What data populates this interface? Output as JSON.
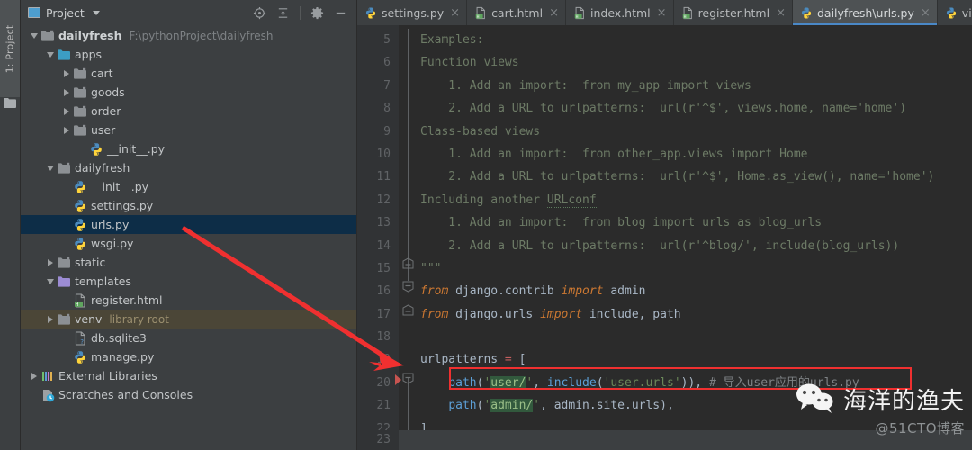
{
  "toolstrip": {
    "tab_label": "1: Project",
    "folder_icon": "folder-icon"
  },
  "project_panel": {
    "title": "Project",
    "dropdown_icon": "chevron-down-icon",
    "actions": [
      {
        "name": "locate-icon",
        "label": "Select Opened File"
      },
      {
        "name": "collapse-all-icon",
        "label": "Collapse All"
      },
      {
        "name": "gear-icon",
        "label": "Settings"
      },
      {
        "name": "minimize-icon",
        "label": "Hide"
      }
    ],
    "tree": [
      {
        "label": "dailyfresh",
        "sub": "F:\\pythonProject\\dailyfresh",
        "indent": 0,
        "twist": "down",
        "icon": "folder-module-icon",
        "bold": true,
        "state": "normal"
      },
      {
        "label": "apps",
        "sub": "",
        "indent": 1,
        "twist": "down",
        "icon": "folder-source-icon",
        "bold": false,
        "state": "normal"
      },
      {
        "label": "cart",
        "sub": "",
        "indent": 2,
        "twist": "right",
        "icon": "folder-icon",
        "bold": false,
        "state": "normal"
      },
      {
        "label": "goods",
        "sub": "",
        "indent": 2,
        "twist": "right",
        "icon": "folder-icon",
        "bold": false,
        "state": "normal"
      },
      {
        "label": "order",
        "sub": "",
        "indent": 2,
        "twist": "right",
        "icon": "folder-icon",
        "bold": false,
        "state": "normal"
      },
      {
        "label": "user",
        "sub": "",
        "indent": 2,
        "twist": "right",
        "icon": "folder-icon",
        "bold": false,
        "state": "normal"
      },
      {
        "label": "__init__.py",
        "sub": "",
        "indent": 3,
        "twist": "none",
        "icon": "python-file-icon",
        "bold": false,
        "state": "normal"
      },
      {
        "label": "dailyfresh",
        "sub": "",
        "indent": 1,
        "twist": "down",
        "icon": "folder-icon",
        "bold": false,
        "state": "normal"
      },
      {
        "label": "__init__.py",
        "sub": "",
        "indent": 2,
        "twist": "none",
        "icon": "python-file-icon",
        "bold": false,
        "state": "normal"
      },
      {
        "label": "settings.py",
        "sub": "",
        "indent": 2,
        "twist": "none",
        "icon": "python-file-icon",
        "bold": false,
        "state": "normal"
      },
      {
        "label": "urls.py",
        "sub": "",
        "indent": 2,
        "twist": "none",
        "icon": "python-file-icon",
        "bold": false,
        "state": "selected"
      },
      {
        "label": "wsgi.py",
        "sub": "",
        "indent": 2,
        "twist": "none",
        "icon": "python-file-icon",
        "bold": false,
        "state": "normal"
      },
      {
        "label": "static",
        "sub": "",
        "indent": 1,
        "twist": "right",
        "icon": "folder-icon",
        "bold": false,
        "state": "normal"
      },
      {
        "label": "templates",
        "sub": "",
        "indent": 1,
        "twist": "down",
        "icon": "folder-template-icon",
        "bold": false,
        "state": "normal"
      },
      {
        "label": "register.html",
        "sub": "",
        "indent": 2,
        "twist": "none",
        "icon": "html-file-icon",
        "bold": false,
        "state": "normal"
      },
      {
        "label": "venv",
        "sub": "library root",
        "indent": 1,
        "twist": "right",
        "icon": "folder-icon",
        "bold": false,
        "state": "hover"
      },
      {
        "label": "db.sqlite3",
        "sub": "",
        "indent": 2,
        "twist": "none",
        "icon": "db-file-icon",
        "bold": false,
        "state": "normal"
      },
      {
        "label": "manage.py",
        "sub": "",
        "indent": 2,
        "twist": "none",
        "icon": "python-file-icon",
        "bold": false,
        "state": "normal"
      },
      {
        "label": "External Libraries",
        "sub": "",
        "indent": 0,
        "twist": "right",
        "icon": "libraries-icon",
        "bold": false,
        "state": "normal"
      },
      {
        "label": "Scratches and Consoles",
        "sub": "",
        "indent": 0,
        "twist": "none",
        "icon": "scratches-icon",
        "bold": false,
        "state": "normal"
      }
    ]
  },
  "editor": {
    "tabs": [
      {
        "label": "settings.py",
        "icon": "python-file-icon",
        "active": false,
        "close": "×"
      },
      {
        "label": "cart.html",
        "icon": "html-file-icon",
        "active": false,
        "close": "×"
      },
      {
        "label": "index.html",
        "icon": "html-file-icon",
        "active": false,
        "close": "×"
      },
      {
        "label": "register.html",
        "icon": "html-file-icon",
        "active": false,
        "close": "×"
      },
      {
        "label": "dailyfresh\\urls.py",
        "icon": "python-file-icon",
        "active": true,
        "close": "×"
      },
      {
        "label": "views.py",
        "icon": "python-file-icon",
        "active": false,
        "close": ""
      }
    ],
    "accent_color": "#4A88C7",
    "line_numbers": [
      "5",
      "6",
      "7",
      "8",
      "9",
      "10",
      "11",
      "12",
      "13",
      "14",
      "15",
      "16",
      "17",
      "18",
      "19",
      "20",
      "21",
      "22"
    ],
    "last_line_number": "23",
    "lines": {
      "l5": "Examples:",
      "l6": "Function views",
      "l7": "    1. Add an import:  from my_app import views",
      "l8": "    2. Add a URL to urlpatterns:  url(r'^$', views.home, name='home')",
      "l9": "Class-based views",
      "l10": "    1. Add an import:  from other_app.views import Home",
      "l11": "    2. Add a URL to urlpatterns:  url(r'^$', Home.as_view(), name='home')",
      "l12a": "Including another ",
      "l12b": "URLconf",
      "l13": "    1. Add an import:  from blog import urls as blog_urls",
      "l14": "    2. Add a URL to urlpatterns:  url(r'^blog/', include(blog_urls))",
      "l15": "\"\"\"",
      "l16_kw1": "from",
      "l16_mod": " django.contrib ",
      "l16_kw2": "import",
      "l16_name": " admin",
      "l17_kw1": "from",
      "l17_mod": " django.urls ",
      "l17_kw2": "import",
      "l17_name": " include, path",
      "l18": "",
      "l19_name": "urlpatterns ",
      "l19_op": "=",
      "l19_br": " [",
      "l20_fn": "path",
      "l20_p1": "(",
      "l20_q1": "'",
      "l20_s1": "user/",
      "l20_q2": "'",
      "l20_c1": ", ",
      "l20_fn2": "include",
      "l20_p2": "(",
      "l20_q3": "'",
      "l20_s2": "user.urls",
      "l20_q4": "'",
      "l20_p3": "))",
      "l20_c2": ", ",
      "l20_cmt": "# 导入user应用的urls.py",
      "l21_fn": "path",
      "l21_p1": "(",
      "l21_q1": "'",
      "l21_s1": "admin/",
      "l21_q2": "'",
      "l21_rest": ", admin.site.urls),",
      "l22": "]"
    }
  },
  "annotations": {
    "box_color": "#F03030",
    "arrow_color": "#F03030",
    "arrow_label": "points-from-urls-py-to-line-20"
  },
  "watermark": {
    "logo": "wechat-icon",
    "name": "海洋的渔夫",
    "handle": "@51CTO博客"
  }
}
